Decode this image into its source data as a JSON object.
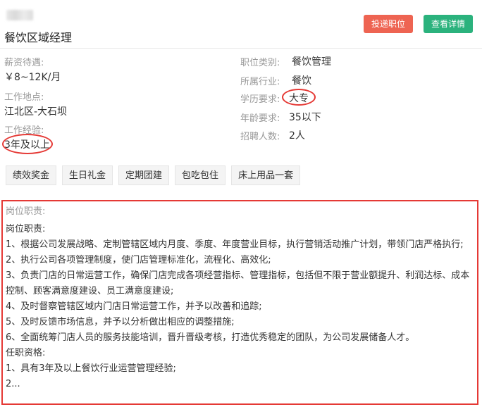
{
  "header": {
    "title": "餐饮区域经理",
    "apply_label": "投递职位",
    "detail_label": "查看详情"
  },
  "info": {
    "salary_label": "薪资待遇:",
    "salary_value": "￥8~12K/月",
    "location_label": "工作地点:",
    "location_value": "江北区-大石坝",
    "experience_label": "工作经验:",
    "experience_value": "3年及以上",
    "category_label": "职位类别:",
    "category_value": "餐饮管理",
    "industry_label": "所属行业:",
    "industry_value": "餐饮",
    "education_label": "学历要求:",
    "education_value": "大专",
    "age_label": "年龄要求:",
    "age_value": "35以下",
    "headcount_label": "招聘人数:",
    "headcount_value": "2人"
  },
  "tags": [
    "绩效奖金",
    "生日礼金",
    "定期团建",
    "包吃包住",
    "床上用品一套"
  ],
  "description": {
    "heading": "岗位职责:",
    "lines": [
      "岗位职责:",
      "1、根据公司发展战略、定制管辖区域内月度、季度、年度营业目标，执行营销活动推广计划，带领门店严格执行;",
      "2、执行公司各项管理制度，使门店管理标准化，流程化、高效化;",
      "3、负责门店的日常运营工作，确保门店完成各项经营指标、管理指标，包括但不限于营业额提升、利润达标、成本控制、顾客满意度建设、员工满意度建设;",
      "4、及时督察管辖区域内门店日常运营工作，并予以改善和追踪;",
      "5、及时反馈市场信息，并予以分析做出相应的调整措施;",
      "6、全面统筹门店人员的服务技能培训，晋升晋级考核，打造优秀稳定的团队，为公司发展储备人才。",
      "任职资格:",
      "1、具有3年及以上餐饮行业运营管理经验;",
      "2..."
    ]
  },
  "colors": {
    "apply_button": "#ee6452",
    "detail_button": "#2bb27d",
    "annotation_red": "#e53935"
  }
}
